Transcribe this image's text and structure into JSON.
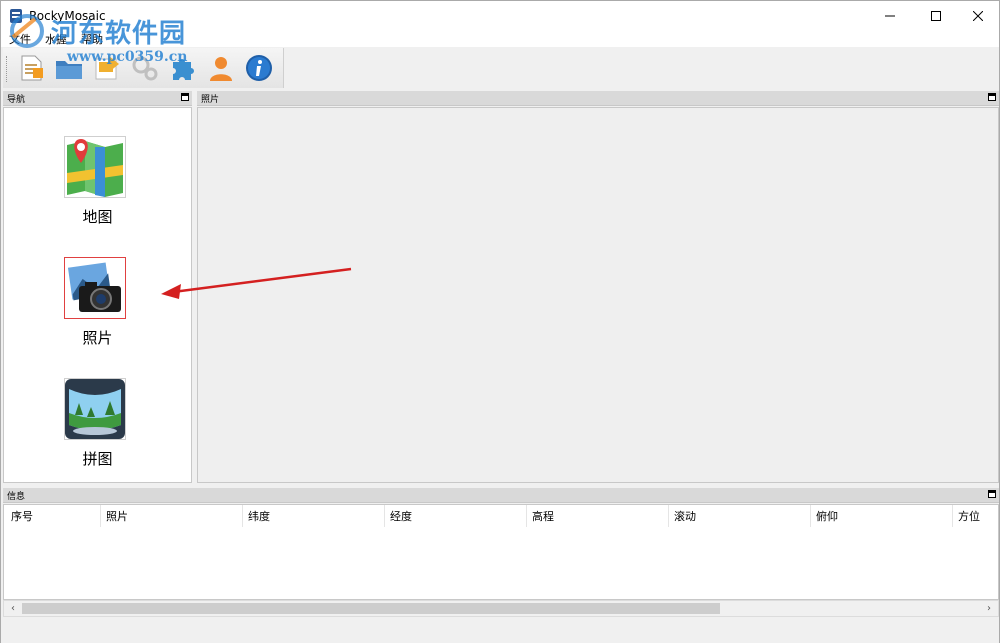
{
  "window": {
    "title": "RockyMosaic"
  },
  "menu": {
    "items": [
      "文件",
      "水握",
      "帮助"
    ]
  },
  "watermark": {
    "line1": "河东软件园",
    "line2": "www.pc0359.cn"
  },
  "toolbar": {
    "buttons": [
      "new-document",
      "open-folder",
      "export",
      "settings",
      "plugins",
      "user",
      "info"
    ]
  },
  "nav": {
    "header": "导航",
    "items": [
      {
        "label": "地图",
        "icon": "map-icon",
        "selected": false
      },
      {
        "label": "照片",
        "icon": "camera-icon",
        "selected": true
      },
      {
        "label": "拼图",
        "icon": "panorama-icon",
        "selected": false
      }
    ]
  },
  "photo": {
    "header": "照片"
  },
  "info": {
    "header": "信息",
    "columns": [
      "序号",
      "照片",
      "纬度",
      "经度",
      "高程",
      "滚动",
      "俯仰",
      "方位"
    ]
  },
  "colors": {
    "annotation_arrow": "#d42020",
    "selected_border": "#e04040",
    "panel_header": "#d9d9d9"
  }
}
